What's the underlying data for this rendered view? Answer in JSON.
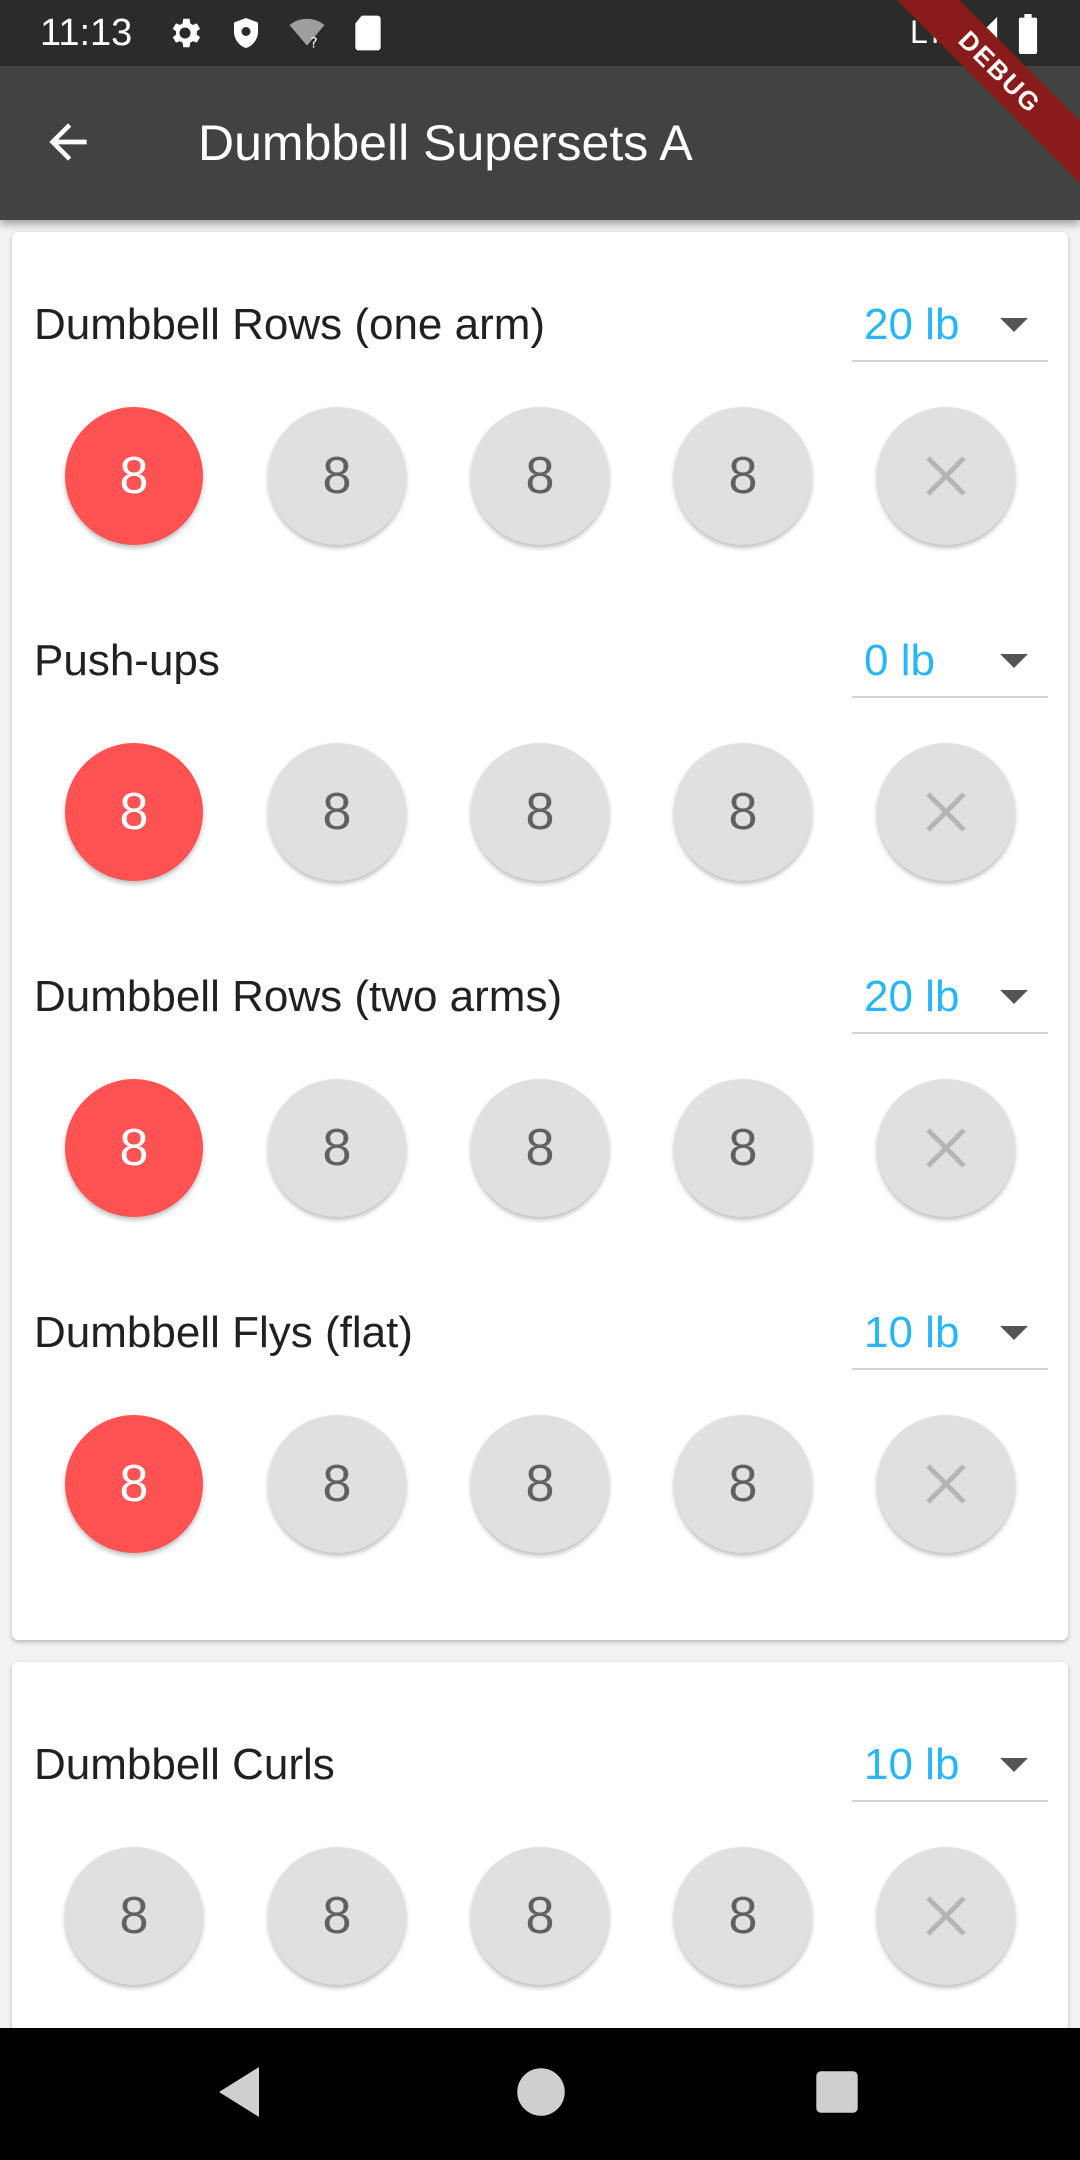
{
  "status_bar": {
    "time": "11:13",
    "network": "LTE",
    "icons": [
      "settings-icon",
      "shield-icon",
      "wifi-question-icon",
      "sd-card-icon",
      "signal-icon",
      "battery-icon"
    ]
  },
  "app_bar": {
    "title": "Dumbbell Supersets A",
    "back_icon": "arrow-back-icon"
  },
  "debug_banner": "DEBUG",
  "colors": {
    "accent": "#29b6f6",
    "rep_done": "#ff5252",
    "rep_pending": "#e0e0e0",
    "app_bar": "#424242"
  },
  "cards": [
    {
      "exercises": [
        {
          "name": "Dumbbell Rows (one arm)",
          "weight": "20 lb",
          "reps": [
            "8",
            "8",
            "8",
            "8"
          ],
          "done": [
            true,
            false,
            false,
            false
          ]
        },
        {
          "name": "Push-ups",
          "weight": "0 lb",
          "reps": [
            "8",
            "8",
            "8",
            "8"
          ],
          "done": [
            true,
            false,
            false,
            false
          ]
        },
        {
          "name": "Dumbbell Rows (two arms)",
          "weight": "20 lb",
          "reps": [
            "8",
            "8",
            "8",
            "8"
          ],
          "done": [
            true,
            false,
            false,
            false
          ]
        },
        {
          "name": "Dumbbell Flys (flat)",
          "weight": "10 lb",
          "reps": [
            "8",
            "8",
            "8",
            "8"
          ],
          "done": [
            true,
            false,
            false,
            false
          ]
        }
      ]
    },
    {
      "exercises": [
        {
          "name": "Dumbbell Curls",
          "weight": "10 lb",
          "reps": [
            "8",
            "8",
            "8",
            "8"
          ],
          "done": [
            false,
            false,
            false,
            false
          ]
        }
      ]
    }
  ],
  "nav_bar": [
    "back-triangle-icon",
    "home-circle-icon",
    "recents-square-icon"
  ]
}
